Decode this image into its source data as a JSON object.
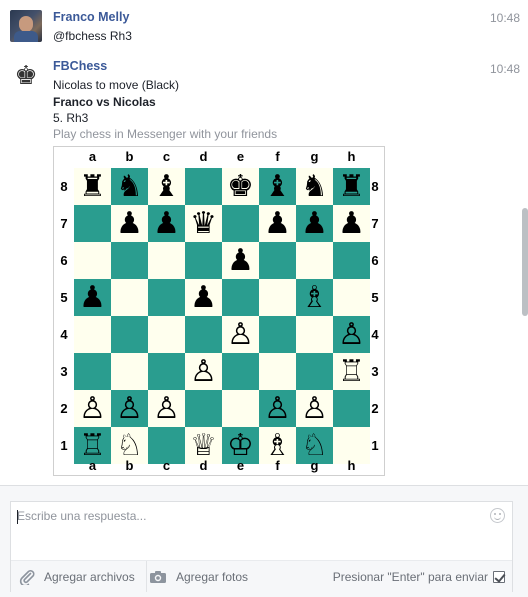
{
  "messages": [
    {
      "sender": "Franco Melly",
      "time": "10:48",
      "text": "@fbchess Rh3"
    },
    {
      "sender": "FBChess",
      "time": "10:48",
      "avatar_glyph": "♚",
      "status": "Nicolas to move (Black)",
      "matchup": "Franco vs Nicolas",
      "last_move": "5. Rh3",
      "tagline": "Play chess in Messenger with your friends"
    }
  ],
  "board": {
    "files": [
      "a",
      "b",
      "c",
      "d",
      "e",
      "f",
      "g",
      "h"
    ],
    "ranks": [
      "8",
      "7",
      "6",
      "5",
      "4",
      "3",
      "2",
      "1"
    ],
    "colors": {
      "light": "#ffffee",
      "dark": "#2a9d8f"
    },
    "squares": [
      [
        "♜",
        "♞",
        "♝",
        "",
        "♚",
        "♝",
        "♞",
        "♜"
      ],
      [
        "",
        "♟",
        "♟",
        "♛",
        "",
        "♟",
        "♟",
        "♟"
      ],
      [
        "",
        "",
        "",
        "",
        "♟",
        "",
        "",
        ""
      ],
      [
        "♟",
        "",
        "",
        "♟",
        "",
        "",
        "♗",
        ""
      ],
      [
        "",
        "",
        "",
        "",
        "♙",
        "",
        "",
        "♙"
      ],
      [
        "",
        "",
        "",
        "♙",
        "",
        "",
        "",
        "♖"
      ],
      [
        "♙",
        "♙",
        "♙",
        "",
        "",
        "♙",
        "♙",
        ""
      ],
      [
        "♖",
        "♘",
        "",
        "♕",
        "♔",
        "♗",
        "♘",
        ""
      ]
    ]
  },
  "composer": {
    "placeholder": "Escribe una respuesta...",
    "attach_label": "Agregar archivos",
    "photo_label": "Agregar fotos",
    "enter_label": "Presionar \"Enter\" para enviar",
    "enter_checked": true
  },
  "theme": {
    "link_color": "#3b5998",
    "muted_color": "#90949c"
  }
}
